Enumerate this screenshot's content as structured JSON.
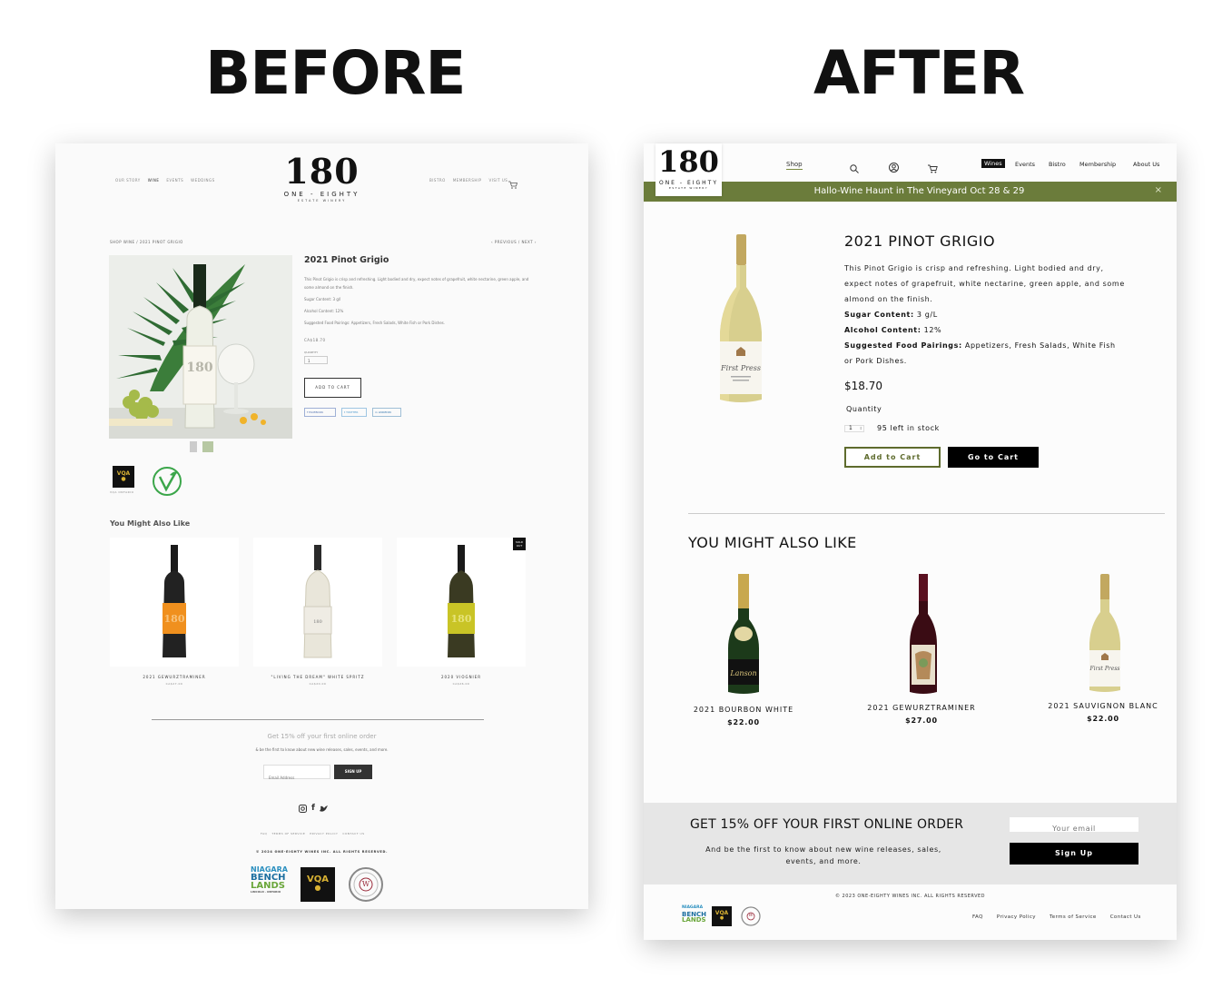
{
  "headings": {
    "before": "BEFORE",
    "after": "AFTER"
  },
  "before": {
    "brand": {
      "number": "180",
      "line1": "ONE - EIGHTY",
      "line2": "ESTATE WINERY"
    },
    "nav_left": [
      "OUR STORY",
      "WINE",
      "EVENTS",
      "WEDDINGS"
    ],
    "nav_right": [
      "BISTRO",
      "MEMBERSHIP",
      "VISIT US"
    ],
    "breadcrumb": "SHOP WINE  /  2021 PINOT GRIGIO",
    "prevnext": "‹ PREVIOUS  /  NEXT ›",
    "product": {
      "title": "2021 Pinot Grigio",
      "description": "This Pinot Grigio is crisp and refreshing. Light bodied and dry, expect notes of grapefruit, white nectarine, green apple, and some almond on the finish.",
      "sugar": "Sugar Content: 3 g/l",
      "alcohol": "Alcohol Content: 12%",
      "pairings": "Suggested Food Pairings: Appetizers, Fresh Salads, White Fish or Pork Dishes.",
      "price": "CA$18.70",
      "quantity_label": "QUANTITY",
      "quantity_value": "1",
      "add_to_cart": "ADD TO CART",
      "share": [
        "FACEBOOK",
        "TWITTER",
        "LINKEDIN"
      ]
    },
    "vqa_caption": "VQA ONTARIO",
    "also_like_title": "You Might Also Like",
    "related": [
      {
        "name": "2021 GEWURZTRAMINER",
        "price": "CA$27.00",
        "label_color": "#f0901e"
      },
      {
        "name": "\"LIVING THE DREAM\" WHITE SPRITZ",
        "price": "CA$20.00",
        "label_color": "#efece4"
      },
      {
        "name": "2020 VIOGNIER",
        "price": "CA$26.00",
        "label_color": "#c9c426"
      }
    ],
    "sold_out": "SOLD OUT",
    "newsletter": {
      "title": "Get 15% off your first online order",
      "text": "& be the first to know about new wine releases, sales, events, and more.",
      "placeholder": "Email Address",
      "button": "SIGN UP"
    },
    "footer_links": [
      "FAQ",
      "TERMS OF SERVICE",
      "PRIVACY POLICY",
      "CONTACT US"
    ],
    "copyright": "© 2024 ONE-EIGHTY WINES INC. ALL RIGHTS RESERVED.",
    "logos": {
      "niagara_1": "NIAGARA",
      "niagara_2": "BENCH",
      "niagara_3": "LANDS",
      "niagara_4": "LINCOLN · ONTARIO",
      "vqa": "VQA",
      "circle": "W"
    }
  },
  "after": {
    "brand": {
      "number": "180",
      "line1": "ONE - EIGHTY",
      "line2": "ESTATE WINERY"
    },
    "nav_shop": "Shop",
    "nav_right": [
      "Wines",
      "Events",
      "Bistro",
      "Membership",
      "About Us"
    ],
    "active_nav": "Wines",
    "announcement": "Hallo-Wine Haunt in The Vineyard Oct 28 & 29",
    "close": "×",
    "product": {
      "title": "2021 PINOT GRIGIO",
      "description": "This Pinot Grigio is crisp and refreshing. Light bodied and dry, expect notes of grapefruit, white nectarine, green apple, and some almond on the finish.",
      "sugar_label": "Sugar Content:",
      "sugar_value": " 3 g/L",
      "alcohol_label": "Alcohol Content:",
      "alcohol_value": " 12%",
      "pairings_label": "Suggested Food Pairings:",
      "pairings_value": " Appetizers, Fresh Salads, White Fish or Pork Dishes.",
      "price": "$18.70",
      "quantity_label": "Quantity",
      "quantity_value": "1",
      "stock": "95 left in stock",
      "add_to_cart": "Add to Cart",
      "go_to_cart": "Go to Cart",
      "bottle_label": "First Press"
    },
    "also_like_title": "YOU MIGHT ALSO LIKE",
    "related": [
      {
        "name": "2021 BOURBON WHITE",
        "price": "$22.00"
      },
      {
        "name": "2021 GEWURZTRAMINER",
        "price": "$27.00"
      },
      {
        "name": "2021 SAUVIGNON BLANC",
        "price": "$22.00"
      }
    ],
    "related_labels": [
      "Lanson",
      "First Press"
    ],
    "newsletter": {
      "title": "GET 15% OFF YOUR FIRST ONLINE ORDER",
      "text": "And be the first to know about new wine releases, sales, events, and more.",
      "placeholder": "Your email",
      "button": "Sign Up"
    },
    "copyright": "© 2023 ONE-EIGHTY WINES INC. ALL RIGHTS RESERVED",
    "footer_links": [
      "FAQ",
      "Privacy Policy",
      "Terms of Service",
      "Contact Us"
    ],
    "logos": {
      "niagara_1": "NIAGARA",
      "niagara_2": "BENCH",
      "niagara_3": "LANDS",
      "vqa": "VQA",
      "circle": "W"
    }
  },
  "colors": {
    "olive_bar": "#6b7c3b",
    "black": "#000000",
    "gold": "#8a7a3a",
    "newsletter_bg": "#e6e6e6"
  }
}
